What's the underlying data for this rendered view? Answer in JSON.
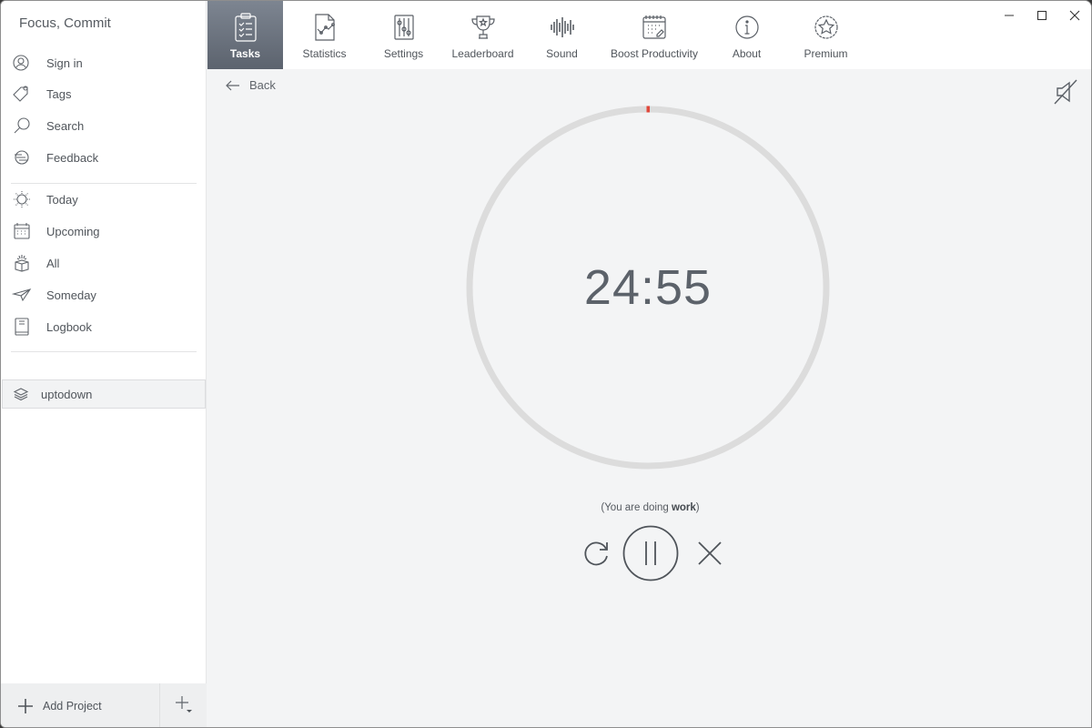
{
  "app": {
    "title": "Focus, Commit"
  },
  "sidebar": {
    "account_items": [
      {
        "label": "Sign in",
        "icon": "user-circle-icon"
      },
      {
        "label": "Tags",
        "icon": "tag-icon"
      },
      {
        "label": "Search",
        "icon": "search-icon"
      },
      {
        "label": "Feedback",
        "icon": "feedback-icon"
      }
    ],
    "list_items": [
      {
        "label": "Today",
        "icon": "sun-icon"
      },
      {
        "label": "Upcoming",
        "icon": "calendar-icon"
      },
      {
        "label": "All",
        "icon": "box-icon"
      },
      {
        "label": "Someday",
        "icon": "paper-plane-icon"
      },
      {
        "label": "Logbook",
        "icon": "book-icon"
      }
    ],
    "projects": [
      {
        "label": "uptodown",
        "icon": "layers-icon",
        "selected": true
      }
    ],
    "footer": {
      "add_project_label": "Add Project"
    }
  },
  "toolbar": {
    "tabs": [
      {
        "label": "Tasks",
        "icon": "clipboard-checklist-icon",
        "active": true
      },
      {
        "label": "Statistics",
        "icon": "chart-document-icon",
        "active": false
      },
      {
        "label": "Settings",
        "icon": "sliders-icon",
        "active": false
      },
      {
        "label": "Leaderboard",
        "icon": "trophy-icon",
        "active": false
      },
      {
        "label": "Sound",
        "icon": "soundwave-icon",
        "active": false
      },
      {
        "label": "Boost Productivity",
        "icon": "calendar-edit-icon",
        "active": false
      },
      {
        "label": "About",
        "icon": "info-icon",
        "active": false
      },
      {
        "label": "Premium",
        "icon": "star-badge-icon",
        "active": false
      }
    ]
  },
  "main": {
    "back_label": "Back",
    "timer": {
      "display": "24:55",
      "elapsed_fraction": 0.0033,
      "track_color": "#dcdcdc",
      "progress_color": "#e0483c"
    },
    "status_prefix": "(You are doing ",
    "status_mode": "work",
    "status_suffix": ")"
  }
}
